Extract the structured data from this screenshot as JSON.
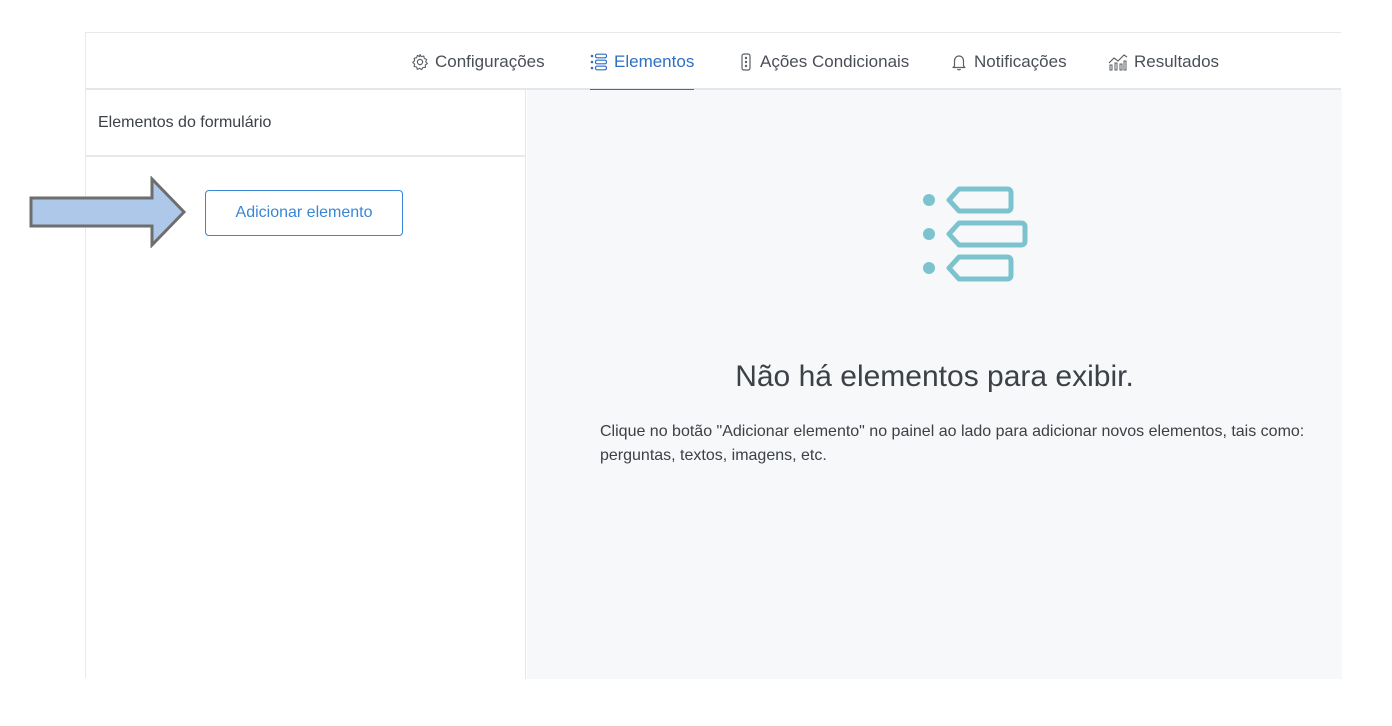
{
  "tabs": [
    {
      "label": "Configurações",
      "icon": "gear-icon",
      "active": false
    },
    {
      "label": "Elementos",
      "icon": "list-icon",
      "active": true
    },
    {
      "label": "Ações Condicionais",
      "icon": "traffic-light-icon",
      "active": false
    },
    {
      "label": "Notificações",
      "icon": "bell-icon",
      "active": false
    },
    {
      "label": "Resultados",
      "icon": "chart-icon",
      "active": false
    }
  ],
  "sidebar": {
    "title": "Elementos do formulário",
    "add_button_label": "Adicionar elemento"
  },
  "empty_state": {
    "icon": "elements-list-icon",
    "title": "Não há elementos para exibir.",
    "description": "Clique no botão \"Adicionar elemento\" no painel ao lado para adicionar novos elementos, tais como: perguntas, textos, imagens, etc."
  },
  "annotation": {
    "icon": "pointer-arrow-icon"
  },
  "colors": {
    "accent": "#2f6fc4",
    "button_border": "#3a86d6",
    "icon_teal": "#7cc3cf",
    "arrow_fill": "#aec8ea",
    "main_bg": "#f7f8f9"
  }
}
